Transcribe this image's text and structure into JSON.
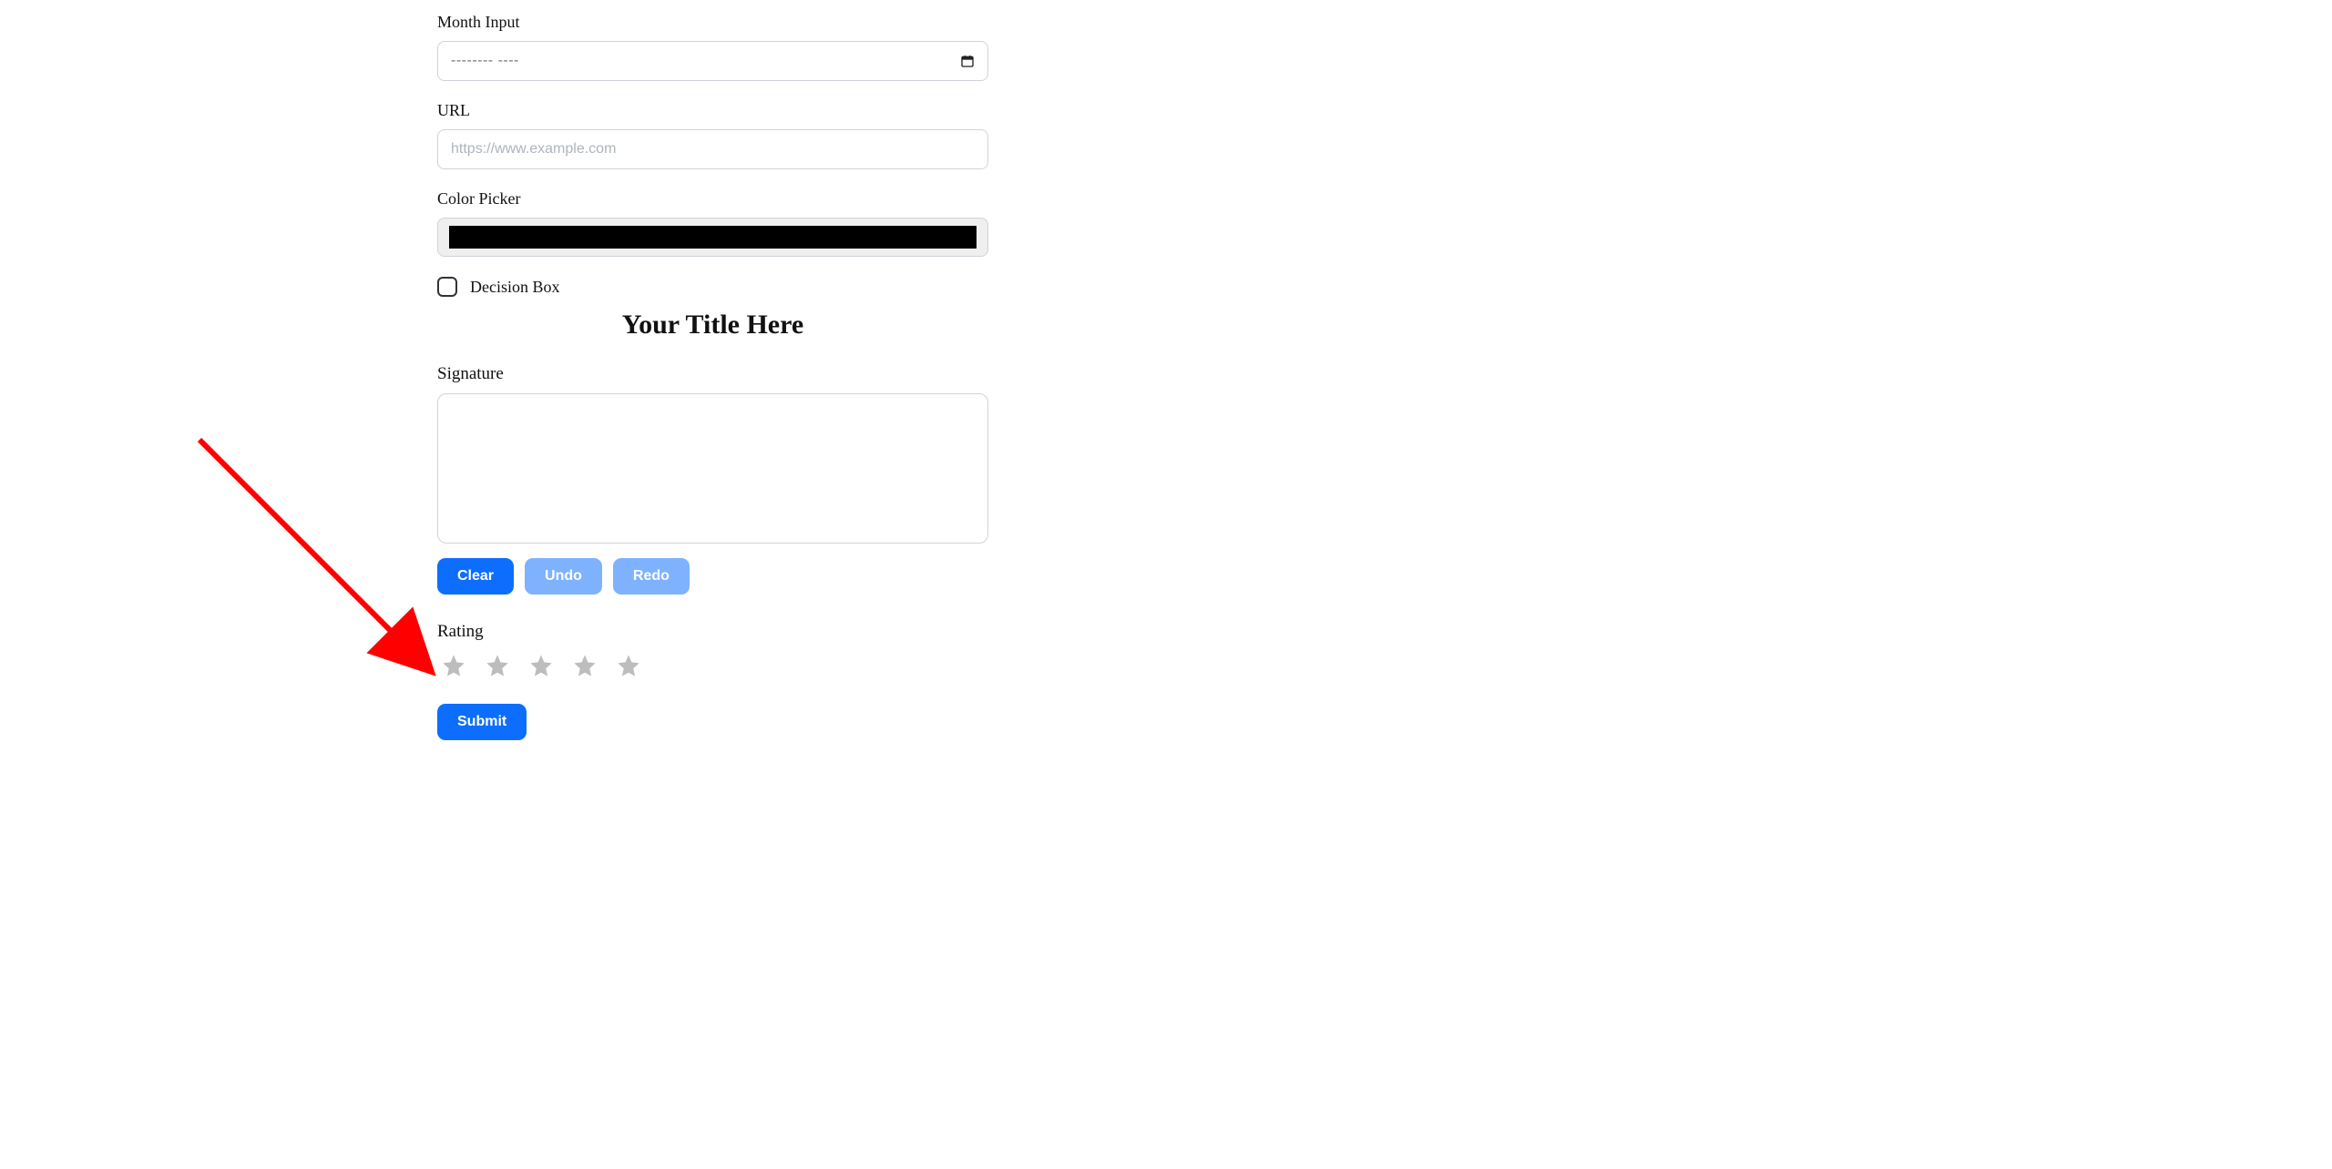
{
  "form": {
    "month": {
      "label": "Month Input",
      "value": "--------  ----"
    },
    "url": {
      "label": "URL",
      "placeholder": "https://www.example.com",
      "value": ""
    },
    "color": {
      "label": "Color Picker",
      "value": "#000000"
    },
    "decision": {
      "label": "Decision Box",
      "checked": false
    }
  },
  "section_title": "Your Title Here",
  "signature": {
    "label": "Signature",
    "buttons": {
      "clear": "Clear",
      "undo": "Undo",
      "redo": "Redo"
    }
  },
  "rating": {
    "label": "Rating",
    "value": 0,
    "max": 5
  },
  "submit_label": "Submit"
}
